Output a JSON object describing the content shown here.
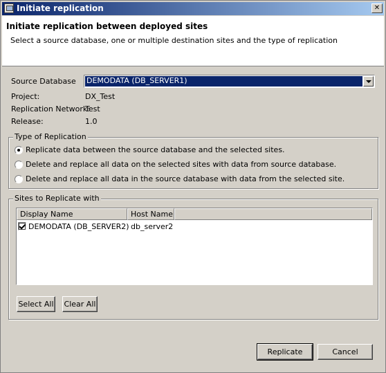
{
  "window": {
    "title": "Initiate replication",
    "close_glyph": "✕"
  },
  "banner": {
    "heading": "Initiate replication between deployed sites",
    "description": "Select a source database, one or multiple destination sites and the type of replication"
  },
  "form": {
    "source_label": "Source Database",
    "source_value": "DEMODATA (DB_SERVER1)",
    "project_label": "Project:",
    "project_value": "DX_Test",
    "network_label": "Replication Network:",
    "network_value": "Test",
    "release_label": "Release:",
    "release_value": "1.0"
  },
  "replication_type": {
    "legend": "Type of Replication",
    "options": [
      {
        "label": "Replicate data between the source database and the selected sites.",
        "selected": true
      },
      {
        "label": "Delete and replace all data on the selected sites with data from source database.",
        "selected": false
      },
      {
        "label": "Delete and replace all data in the source database with data from the selected site.",
        "selected": false
      }
    ]
  },
  "sites": {
    "legend": "Sites to Replicate with",
    "columns": [
      "Display Name",
      "Host Name"
    ],
    "rows": [
      {
        "display_name": "DEMODATA (DB_SERVER2)",
        "host_name": "db_server2",
        "checked": true
      }
    ],
    "select_all": "Select All",
    "clear_all": "Clear All"
  },
  "footer": {
    "replicate": "Replicate",
    "cancel": "Cancel"
  }
}
